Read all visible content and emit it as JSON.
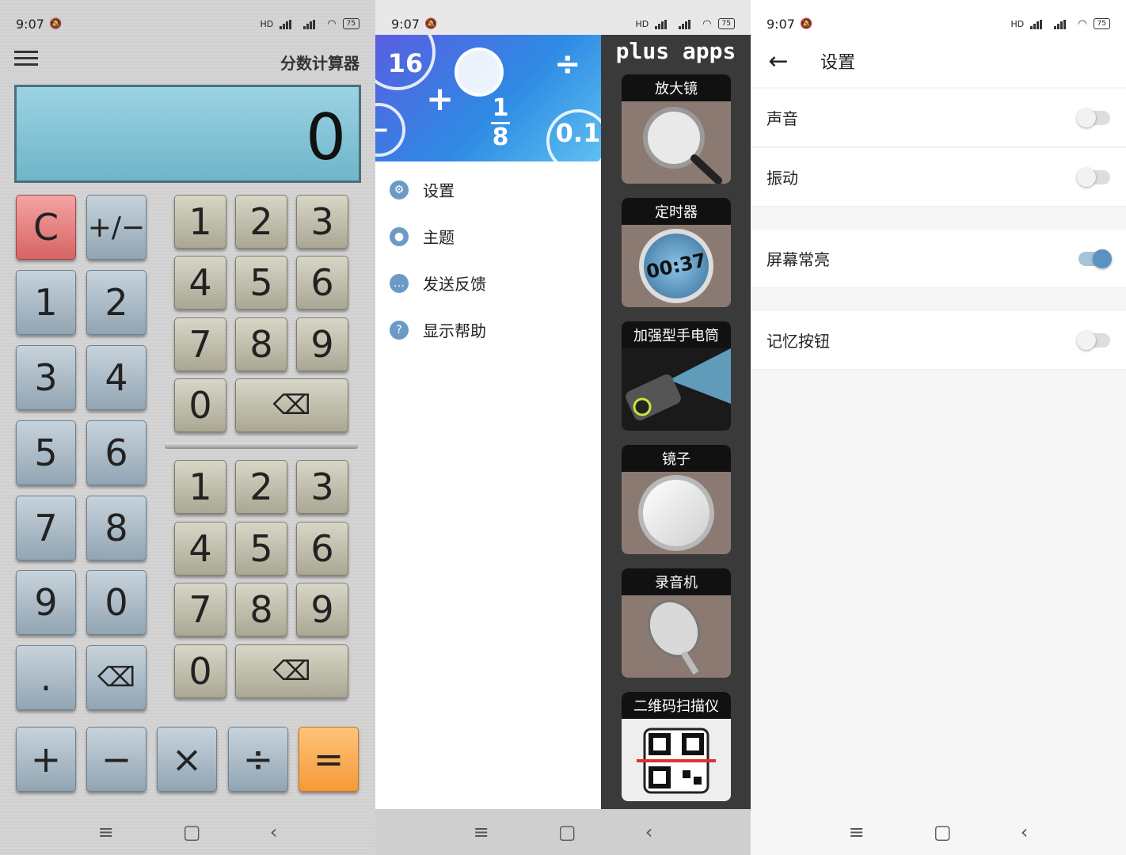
{
  "status": {
    "time": "9:07",
    "battery": "75",
    "hd": "HD"
  },
  "calculator": {
    "title": "分数计算器",
    "display": "0",
    "clear": "C",
    "sign": "+/−",
    "left_keys": [
      "1",
      "2",
      "3",
      "4",
      "5",
      "6",
      "7",
      "8",
      "9",
      "0",
      ".",
      "⌫"
    ],
    "ops": [
      "+",
      "−",
      "×",
      "÷",
      "="
    ],
    "top_grid": [
      "1",
      "2",
      "3",
      "4",
      "5",
      "6",
      "7",
      "8",
      "9",
      "0"
    ],
    "bottom_grid": [
      "1",
      "2",
      "3",
      "4",
      "5",
      "6",
      "7",
      "8",
      "9",
      "0"
    ]
  },
  "drawer": {
    "header_numbers": [
      "16",
      "1",
      "8",
      "0.1"
    ],
    "items": [
      {
        "label": "设置",
        "icon": "gear-icon"
      },
      {
        "label": "主题",
        "icon": "palette-icon"
      },
      {
        "label": "发送反馈",
        "icon": "chat-icon"
      },
      {
        "label": "显示帮助",
        "icon": "help-icon"
      }
    ],
    "promo_title": "plus apps",
    "promos": [
      "放大镜",
      "定时器",
      "加强型手电筒",
      "镜子",
      "录音机",
      "二维码扫描仪"
    ],
    "timer_text": "00:37"
  },
  "settings": {
    "title": "设置",
    "items": [
      {
        "label": "声音",
        "on": false
      },
      {
        "label": "振动",
        "on": false
      },
      {
        "label": "屏幕常亮",
        "on": true
      },
      {
        "label": "记忆按钮",
        "on": false
      }
    ]
  },
  "colors": {
    "accent": "#5b92bf",
    "display_bg": "#8ccbdd",
    "clear_key": "#e07070",
    "equals_key": "#f59a36"
  }
}
